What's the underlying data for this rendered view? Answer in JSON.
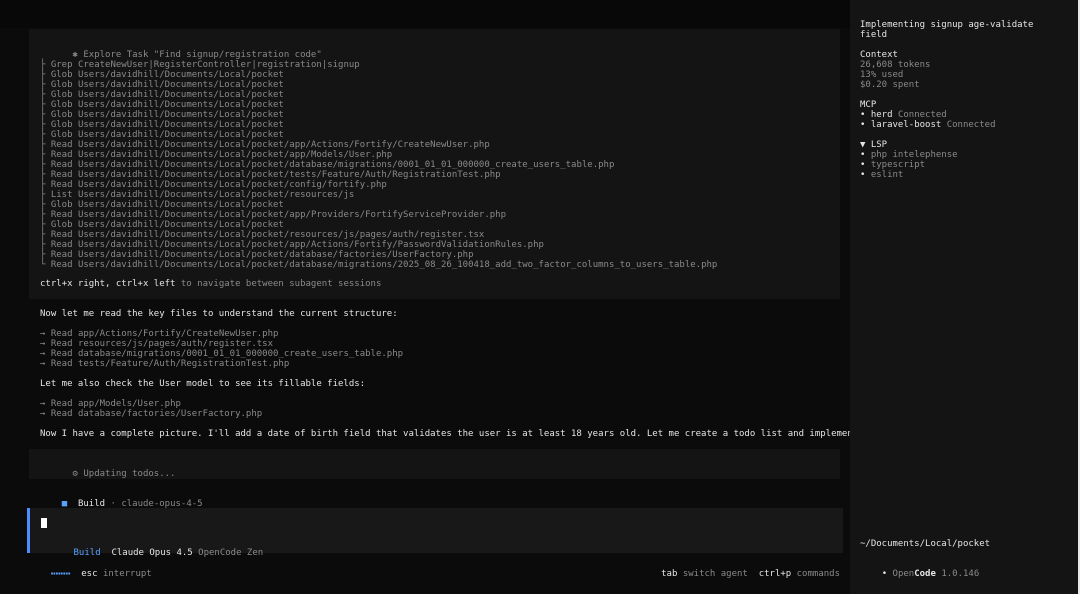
{
  "explore": {
    "header_glyph": "✱",
    "header": "Explore Task \"Find signup/registration code\"",
    "items": [
      {
        "branch": "├",
        "tool": "Grep",
        "arg": "CreateNewUser|RegisterController|registration|signup"
      },
      {
        "branch": "├",
        "tool": "Glob",
        "arg": "Users/davidhill/Documents/Local/pocket"
      },
      {
        "branch": "├",
        "tool": "Glob",
        "arg": "Users/davidhill/Documents/Local/pocket"
      },
      {
        "branch": "├",
        "tool": "Glob",
        "arg": "Users/davidhill/Documents/Local/pocket"
      },
      {
        "branch": "├",
        "tool": "Glob",
        "arg": "Users/davidhill/Documents/Local/pocket"
      },
      {
        "branch": "├",
        "tool": "Glob",
        "arg": "Users/davidhill/Documents/Local/pocket"
      },
      {
        "branch": "├",
        "tool": "Glob",
        "arg": "Users/davidhill/Documents/Local/pocket"
      },
      {
        "branch": "├",
        "tool": "Glob",
        "arg": "Users/davidhill/Documents/Local/pocket"
      },
      {
        "branch": "├",
        "tool": "Read",
        "arg": "Users/davidhill/Documents/Local/pocket/app/Actions/Fortify/CreateNewUser.php"
      },
      {
        "branch": "├",
        "tool": "Read",
        "arg": "Users/davidhill/Documents/Local/pocket/app/Models/User.php"
      },
      {
        "branch": "├",
        "tool": "Read",
        "arg": "Users/davidhill/Documents/Local/pocket/database/migrations/0001_01_01_000000_create_users_table.php"
      },
      {
        "branch": "├",
        "tool": "Read",
        "arg": "Users/davidhill/Documents/Local/pocket/tests/Feature/Auth/RegistrationTest.php"
      },
      {
        "branch": "├",
        "tool": "Read",
        "arg": "Users/davidhill/Documents/Local/pocket/config/fortify.php"
      },
      {
        "branch": "├",
        "tool": "List",
        "arg": "Users/davidhill/Documents/Local/pocket/resources/js"
      },
      {
        "branch": "├",
        "tool": "Glob",
        "arg": "Users/davidhill/Documents/Local/pocket"
      },
      {
        "branch": "├",
        "tool": "Read",
        "arg": "Users/davidhill/Documents/Local/pocket/app/Providers/FortifyServiceProvider.php"
      },
      {
        "branch": "├",
        "tool": "Glob",
        "arg": "Users/davidhill/Documents/Local/pocket"
      },
      {
        "branch": "├",
        "tool": "Read",
        "arg": "Users/davidhill/Documents/Local/pocket/resources/js/pages/auth/register.tsx"
      },
      {
        "branch": "├",
        "tool": "Read",
        "arg": "Users/davidhill/Documents/Local/pocket/app/Actions/Fortify/PasswordValidationRules.php"
      },
      {
        "branch": "├",
        "tool": "Read",
        "arg": "Users/davidhill/Documents/Local/pocket/database/factories/UserFactory.php"
      },
      {
        "branch": "└",
        "tool": "Read",
        "arg": "Users/davidhill/Documents/Local/pocket/database/migrations/2025_08_26_100418_add_two_factor_columns_to_users_table.php"
      }
    ],
    "nav_keys": "ctrl+x right, ctrl+x left",
    "nav_hint": "to navigate between subagent sessions"
  },
  "message1": "Now let me read the key files to understand the current structure:",
  "reads1": [
    {
      "arrow": "→",
      "tool": "Read",
      "arg": "app/Actions/Fortify/CreateNewUser.php"
    },
    {
      "arrow": "→",
      "tool": "Read",
      "arg": "resources/js/pages/auth/register.tsx"
    },
    {
      "arrow": "→",
      "tool": "Read",
      "arg": "database/migrations/0001_01_01_000000_create_users_table.php"
    },
    {
      "arrow": "→",
      "tool": "Read",
      "arg": "tests/Feature/Auth/RegistrationTest.php"
    }
  ],
  "message2": "Let me also check the User model to see its fillable fields:",
  "reads2": [
    {
      "arrow": "→",
      "tool": "Read",
      "arg": "app/Models/User.php"
    },
    {
      "arrow": "→",
      "tool": "Read",
      "arg": "database/factories/UserFactory.php"
    }
  ],
  "message3": "Now I have a complete picture. I'll add a date of birth field that validates the user is at least 18 years old. Let me create a todo list and implement this:",
  "todos": {
    "glyph": "⚙",
    "text": "Updating todos..."
  },
  "build": {
    "glyph": "■",
    "label": "Build",
    "sep": "·",
    "model": "claude-opus-4-5"
  },
  "input": {
    "agent": "Build",
    "model": "Claude Opus 4.5",
    "provider": "OpenCode Zen"
  },
  "statusbar": {
    "spinner": "⬝⬝⬝⬝⬝⬝⬝⬝",
    "esc_key": "esc",
    "esc_label": "interrupt",
    "tab_key": "tab",
    "tab_label": "switch agent",
    "cmd_key": "ctrl+p",
    "cmd_label": "commands"
  },
  "sidebar": {
    "title": "Implementing signup age-validate field",
    "context_heading": "Context",
    "tokens": "26,608 tokens",
    "used": "13% used",
    "spent": "$0.20 spent",
    "mcp_heading": "MCP",
    "mcp": [
      {
        "bullet": "•",
        "name": "herd",
        "status": "Connected"
      },
      {
        "bullet": "•",
        "name": "laravel-boost",
        "status": "Connected"
      }
    ],
    "lsp_caret": "▼",
    "lsp_heading": "LSP",
    "lsp": [
      {
        "bullet": "•",
        "name": "php intelephense"
      },
      {
        "bullet": "•",
        "name": "typescript"
      },
      {
        "bullet": "•",
        "name": "eslint"
      }
    ],
    "cwd": "~/Documents/Local/pocket",
    "brand_bullet": "•",
    "brand_open": "Open",
    "brand_code": "Code",
    "version": "1.0.146"
  },
  "colors": {
    "accent": "#4e8dff",
    "blue_text": "#5aa0ff",
    "bg": "#0b0b0b",
    "panel": "#141414"
  }
}
